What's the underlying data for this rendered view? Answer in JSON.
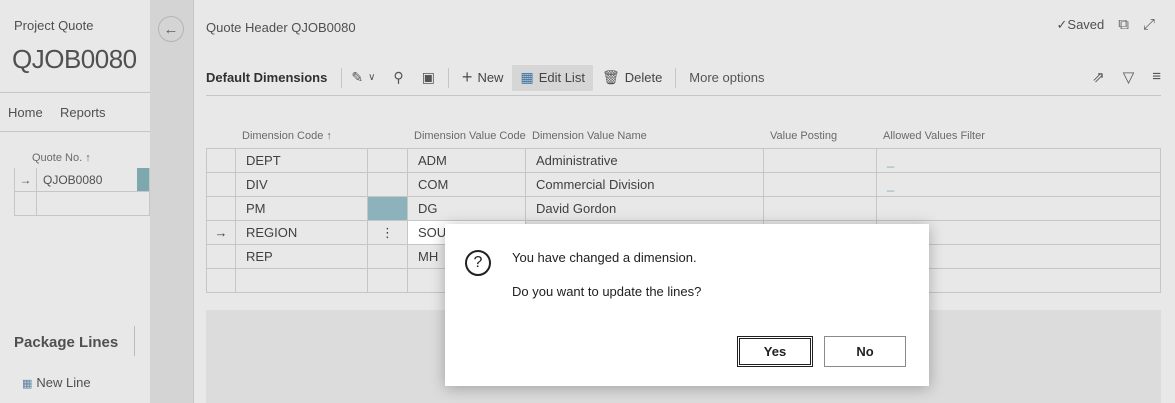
{
  "background": {
    "page_title": "Project Quote",
    "big_title": "QJOB0080",
    "tabs": [
      "Home",
      "Reports"
    ],
    "list_column": "Quote No. ↑",
    "list_rows": [
      {
        "mark": "→",
        "value": "QJOB0080"
      },
      {
        "mark": "",
        "value": ""
      }
    ],
    "package_lines": "Package Lines",
    "new_line": "New Line"
  },
  "panel": {
    "header": "Quote Header QJOB0080",
    "saved": "✓Saved",
    "toolbar": {
      "title": "Default Dimensions",
      "new": "New",
      "edit_list": "Edit List",
      "delete": "Delete",
      "more": "More options"
    },
    "columns": [
      "Dimension Code ↑",
      "Dimension Value Code",
      "Dimension Value Name",
      "Value Posting",
      "Allowed Values Filter"
    ],
    "rows": [
      {
        "mark": "",
        "code": "DEPT",
        "value_code": "ADM",
        "value_name": "Administrative",
        "posting": "",
        "filter": "_"
      },
      {
        "mark": "",
        "code": "DIV",
        "value_code": "COM",
        "value_name": "Commercial Division",
        "posting": "",
        "filter": "_"
      },
      {
        "mark": "",
        "code": "PM",
        "value_code": "DG",
        "value_name": "David Gordon",
        "posting": "",
        "filter": ""
      },
      {
        "mark": "→",
        "code": "REGION",
        "value_code": "SOUT",
        "value_name": "",
        "posting": "",
        "filter": ""
      },
      {
        "mark": "",
        "code": "REP",
        "value_code": "MH",
        "value_name": "",
        "posting": "",
        "filter": ""
      },
      {
        "mark": "",
        "code": "",
        "value_code": "",
        "value_name": "",
        "posting": "",
        "filter": ""
      }
    ]
  },
  "dialog": {
    "message": "You have changed a dimension.",
    "question": "Do you want to update the lines?",
    "yes": "Yes",
    "no": "No"
  }
}
